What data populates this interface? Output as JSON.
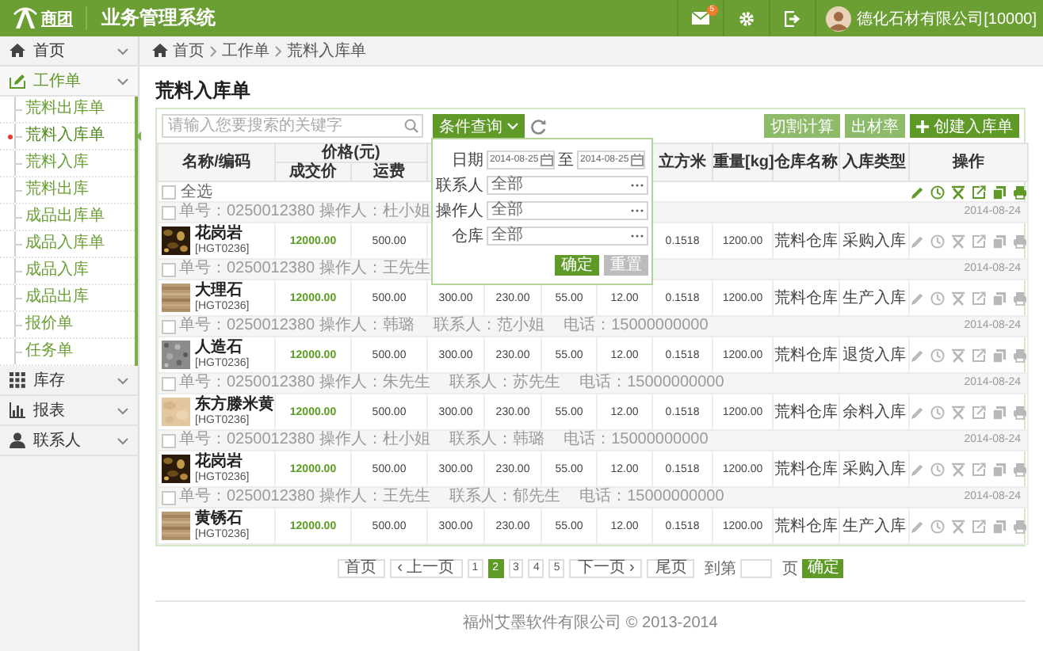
{
  "header": {
    "logo_text": "商团",
    "title": "业务管理系统",
    "mail_badge": "5",
    "user": "德化石材有限公司[10000]"
  },
  "sidebar": {
    "items": [
      {
        "label": "首页",
        "expanded": false
      },
      {
        "label": "工作单",
        "expanded": true,
        "children": [
          {
            "label": "荒料出库单",
            "selected": false
          },
          {
            "label": "荒料入库单",
            "selected": true
          },
          {
            "label": "荒料入库",
            "selected": false
          },
          {
            "label": "荒料出库",
            "selected": false
          },
          {
            "label": "成品出库单",
            "selected": false
          },
          {
            "label": "成品入库单",
            "selected": false
          },
          {
            "label": "成品入库",
            "selected": false
          },
          {
            "label": "成品出库",
            "selected": false
          },
          {
            "label": "报价单",
            "selected": false
          },
          {
            "label": "任务单",
            "selected": false
          }
        ]
      },
      {
        "label": "库存",
        "expanded": false
      },
      {
        "label": "报表",
        "expanded": false
      },
      {
        "label": "联系人",
        "expanded": false
      }
    ]
  },
  "breadcrumb": [
    "首页",
    "工作单",
    "荒料入库单"
  ],
  "page_title": "荒料入库单",
  "toolbar": {
    "search_placeholder": "请输入您要搜索的关键字",
    "filter_button": "条件查询",
    "actions": [
      {
        "label": "切割计算",
        "kind": "secondary"
      },
      {
        "label": "出材率",
        "kind": "secondary"
      },
      {
        "label": "创建入库单",
        "kind": "primary"
      }
    ]
  },
  "filter_panel": {
    "date_label": "日期",
    "date_from": "2014-08-25",
    "date_separator": "至",
    "date_to": "2014-08-25",
    "fields": [
      {
        "label": "联系人",
        "value": "全部"
      },
      {
        "label": "操作人",
        "value": "全部"
      },
      {
        "label": "仓库",
        "value": "全部"
      }
    ],
    "confirm": "确定",
    "reset": "重置"
  },
  "table": {
    "name_header": "名称/编码",
    "price_group": "价格(元)",
    "price_columns": [
      "成交价",
      "运费"
    ],
    "columns": [
      "立方米",
      "重量[kg]",
      "仓库名称",
      "入库类型",
      "操作"
    ],
    "select_all": {
      "label": "全选",
      "checked": false
    },
    "groups": [
      {
        "checked": false,
        "order_no": "单号：0250012380",
        "operator": "操作人：杜小姐",
        "date": "2014-08-24",
        "name": "花岗岩",
        "code": "[HGT0236]",
        "cells": [
          "12000.00",
          "500.00",
          null,
          null,
          null,
          null,
          "0.1518",
          "1200.00",
          "荒料仓库",
          "采购入库"
        ]
      },
      {
        "checked": false,
        "order_no": "单号：0250012380",
        "operator": "操作人：王先生",
        "date": "2014-08-24",
        "name": "大理石",
        "code": "[HGT0236]",
        "cells": [
          "12000.00",
          "500.00",
          "300.00",
          "230.00",
          "55.00",
          "12.00",
          "0.1518",
          "1200.00",
          "荒料仓库",
          "生产入库"
        ]
      },
      {
        "checked": false,
        "order_no": "单号：0250012380",
        "operator": "操作人：韩璐",
        "contact": "联系人：范小姐",
        "phone": "电话：15000000000",
        "date": "2014-08-24",
        "name": "人造石",
        "code": "[HGT0236]",
        "cells": [
          "12000.00",
          "500.00",
          "300.00",
          "230.00",
          "55.00",
          "12.00",
          "0.1518",
          "1200.00",
          "荒料仓库",
          "退货入库"
        ]
      },
      {
        "checked": false,
        "order_no": "单号：0250012380",
        "operator": "操作人：朱先生",
        "contact": "联系人：苏先生",
        "phone": "电话：15000000000",
        "date": "2014-08-24",
        "name": "东方滕米黄",
        "code": "[HGT0236]",
        "cells": [
          "12000.00",
          "500.00",
          "300.00",
          "230.00",
          "55.00",
          "12.00",
          "0.1518",
          "1200.00",
          "荒料仓库",
          "余料入库"
        ]
      },
      {
        "checked": false,
        "order_no": "单号：0250012380",
        "operator": "操作人：杜小姐",
        "contact": "联系人：韩璐",
        "phone": "电话：15000000000",
        "date": "2014-08-24",
        "name": "花岗岩",
        "code": "[HGT0236]",
        "cells": [
          "12000.00",
          "500.00",
          "300.00",
          "230.00",
          "55.00",
          "12.00",
          "0.1518",
          "1200.00",
          "荒料仓库",
          "采购入库"
        ]
      },
      {
        "checked": false,
        "order_no": "单号：0250012380",
        "operator": "操作人：王先生",
        "contact": "联系人：郁先生",
        "phone": "电话：15000000000",
        "date": "2014-08-24",
        "name": "黄锈石",
        "code": "[HGT0236]",
        "cells": [
          "12000.00",
          "500.00",
          "300.00",
          "230.00",
          "55.00",
          "12.00",
          "0.1518",
          "1200.00",
          "荒料仓库",
          "生产入库"
        ]
      }
    ]
  },
  "pagination": {
    "first": "首页",
    "prev": "‹ 上一页",
    "pages": [
      {
        "label": "1",
        "selected": false
      },
      {
        "label": "2",
        "selected": true
      },
      {
        "label": "3",
        "selected": false
      },
      {
        "label": "4",
        "selected": false
      },
      {
        "label": "5",
        "selected": false
      }
    ],
    "next": "下一页 ›",
    "last": "尾页",
    "goto_prefix": "到第",
    "goto_suffix": "页",
    "goto_button": "确定"
  },
  "footer": "福州艾墨软件有限公司 © 2013-2014"
}
